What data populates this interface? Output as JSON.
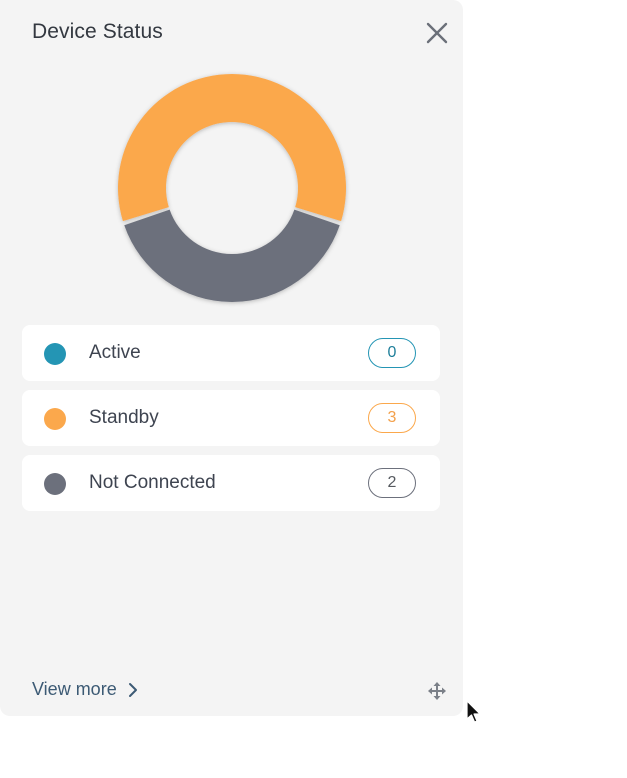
{
  "widget": {
    "title": "Device Status",
    "close_icon": "close-icon",
    "view_more_label": "View more",
    "view_more_icon": "chevron-right-icon",
    "move_icon": "move-arrows-icon"
  },
  "chart_data": {
    "type": "pie",
    "title": "",
    "categories": [
      "Active",
      "Standby",
      "Not Connected"
    ],
    "values": [
      0,
      3,
      2
    ],
    "colors": [
      "#2495b4",
      "#fba84c",
      "#6c707c"
    ],
    "style": "donut"
  },
  "legend": [
    {
      "label": "Active",
      "count": "0",
      "color": "#2495b4",
      "text_color": "#1f7f9a"
    },
    {
      "label": "Standby",
      "count": "3",
      "color": "#fba84c",
      "text_color": "#f3a04a"
    },
    {
      "label": "Not Connected",
      "count": "2",
      "color": "#6c707c",
      "text_color": "#55595f"
    }
  ],
  "cursor": {
    "icon": "mouse-pointer-icon"
  }
}
